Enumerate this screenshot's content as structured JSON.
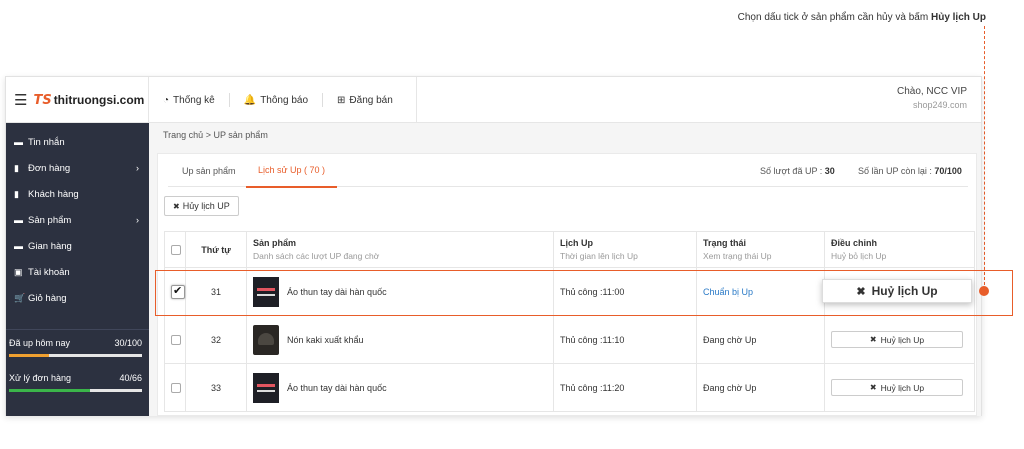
{
  "annotation": {
    "text": "Chọn dấu tick ở sản phẩm cần hủy và bấm ",
    "bold": "Hủy lịch Up"
  },
  "brand": {
    "mark": "TS",
    "name": "thitruongsi.com"
  },
  "topnav": [
    {
      "icon": "pie-chart-icon",
      "glyph": "◔",
      "label": "Thống kê"
    },
    {
      "icon": "bell-icon",
      "glyph": "🔔",
      "label": "Thông báo"
    },
    {
      "icon": "plus-square-icon",
      "glyph": "⊞",
      "label": "Đăng bán"
    }
  ],
  "user": {
    "greeting": "Chào, NCC VIP",
    "shop": "shop249.com"
  },
  "sidebar": {
    "items": [
      {
        "icon": "chat-icon",
        "glyph": "▬",
        "label": "Tin nhắn",
        "chevron": ""
      },
      {
        "icon": "document-icon",
        "glyph": "▮",
        "label": "Đơn hàng",
        "chevron": "›"
      },
      {
        "icon": "users-icon",
        "glyph": "▮",
        "label": "Khách hàng",
        "chevron": ""
      },
      {
        "icon": "card-icon",
        "glyph": "▬",
        "label": "Sản phẩm",
        "chevron": "›"
      },
      {
        "icon": "store-icon",
        "glyph": "▬",
        "label": "Gian hàng",
        "chevron": ""
      },
      {
        "icon": "account-icon",
        "glyph": "▣",
        "label": "Tài khoản",
        "chevron": ""
      },
      {
        "icon": "cart-icon",
        "glyph": "🛒",
        "label": "Giỏ hàng",
        "chevron": ""
      }
    ],
    "stats": [
      {
        "label": "Đã up hôm nay",
        "value": "30/100",
        "fraction": 0.3,
        "color": "#f0a030"
      },
      {
        "label": "Xử lý đơn hàng",
        "value": "40/66",
        "fraction": 0.606,
        "color": "#3bb54a"
      }
    ]
  },
  "breadcrumb": "Trang chủ > UP sản phẩm",
  "tabs": [
    {
      "label": "Up sản phẩm",
      "active": false
    },
    {
      "label": "Lịch sử Up ( 70 )",
      "active": true
    }
  ],
  "tab_stats": {
    "used_label": "Số lượt đã UP : ",
    "used_value": "30",
    "left_label": "Số lần UP còn lại : ",
    "left_value": "70/100"
  },
  "cancel_button": "Hủy lịch UP",
  "table": {
    "headers": [
      {
        "title": "",
        "sub": ""
      },
      {
        "title": "Thứ tự",
        "sub": ""
      },
      {
        "title": "Sản phẩm",
        "sub": "Danh sách các lượt UP đang chờ"
      },
      {
        "title": "Lịch Up",
        "sub": "Thời gian lên lịch Up"
      },
      {
        "title": "Trạng thái",
        "sub": "Xem trạng thái Up"
      },
      {
        "title": "Điều chỉnh",
        "sub": "Huỷ bỏ lịch Up"
      }
    ],
    "rows": [
      {
        "checked": true,
        "order": "31",
        "thumb": "shirt",
        "product": "Áo thun tay dài hàn quốc",
        "schedule": "Thủ công :11:00",
        "status": "Chuẩn bị Up",
        "status_link": true,
        "action": "Huỷ lịch Up"
      },
      {
        "checked": false,
        "order": "32",
        "thumb": "hat",
        "product": "Nón kaki xuất khẩu",
        "schedule": "Thủ công :11:10",
        "status": "Đang chờ Up",
        "status_link": false,
        "action": "Huỷ lịch Up"
      },
      {
        "checked": false,
        "order": "33",
        "thumb": "shirt",
        "product": "Áo thun tay dài hàn quốc",
        "schedule": "Thủ công :11:20",
        "status": "Đang chờ Up",
        "status_link": false,
        "action": "Huỷ lịch Up"
      }
    ]
  },
  "colors": {
    "accent": "#e85d2a",
    "sidebar_bg": "#2c3140",
    "link": "#2a7ac7"
  }
}
